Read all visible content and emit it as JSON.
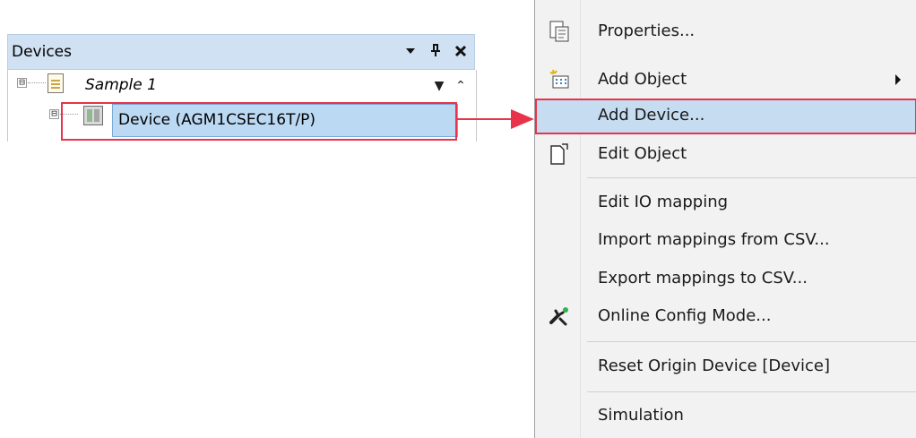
{
  "devices_panel": {
    "title": "Devices",
    "header_icons": [
      "dropdown-arrow-icon",
      "pin-icon",
      "close-icon"
    ],
    "tree": {
      "project": {
        "label": "Sample 1",
        "expander": "⊟",
        "icon": "project-icon"
      },
      "device": {
        "label": "Device (AGM1CSEC16T/P)",
        "expander": "⊟",
        "icon": "device-icon",
        "selected": true
      }
    }
  },
  "context_menu": {
    "items": [
      {
        "label": "Properties...",
        "icon": "properties-icon"
      },
      {
        "label": "Add Object",
        "icon": "add-object-icon",
        "has_submenu": true
      },
      {
        "label": "Add Device...",
        "highlighted": true
      },
      {
        "label": "Edit Object",
        "icon": "edit-object-icon"
      },
      {
        "label": "Edit IO mapping"
      },
      {
        "label": "Import mappings from CSV..."
      },
      {
        "label": "Export mappings to CSV..."
      },
      {
        "label": "Online Config Mode...",
        "icon": "online-config-icon"
      },
      {
        "label": "Reset Origin Device [Device]"
      },
      {
        "label": "Simulation"
      }
    ]
  },
  "colors": {
    "highlight_outline": "#e8334a",
    "selection_fill": "#c6dcf0",
    "header_fill": "#cfe1f2",
    "menu_background": "#f2f2f2"
  }
}
